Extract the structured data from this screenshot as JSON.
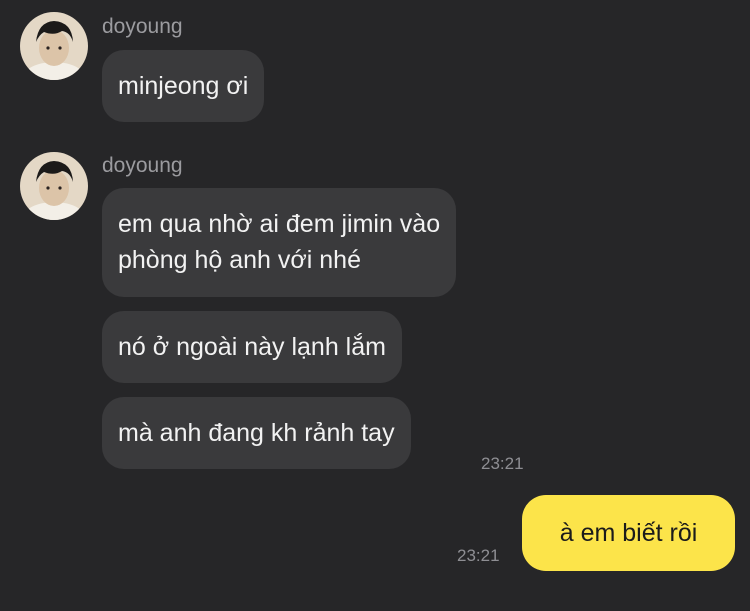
{
  "chat": {
    "groups": [
      {
        "sender": "doyoung",
        "messages": [
          {
            "text": "minjeong ơi"
          }
        ]
      },
      {
        "sender": "doyoung",
        "messages": [
          {
            "lines": [
              "em qua nhờ ai đem jimin vào",
              "phòng hộ anh với nhé"
            ]
          },
          {
            "text": "nó ở ngoài này lạnh lắm"
          },
          {
            "text": "mà anh đang kh rảnh tay"
          }
        ],
        "time": "23:21"
      }
    ],
    "outgoing": {
      "text": "à em biết rồi",
      "time": "23:21"
    }
  },
  "colors": {
    "background": "#262628",
    "incoming_bubble": "#3a3a3c",
    "outgoing_bubble": "#fce44a",
    "sender_text": "#9b9b9f",
    "timestamp": "#8e8e93"
  }
}
